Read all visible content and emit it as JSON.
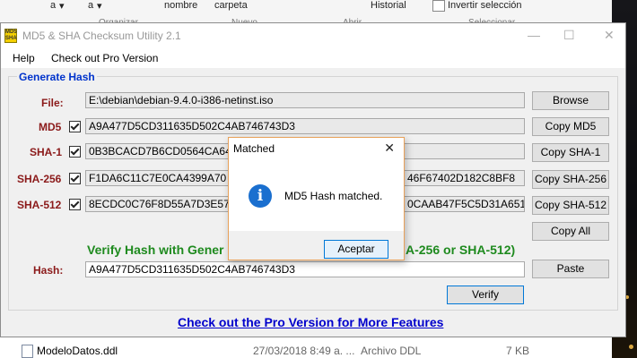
{
  "background": {
    "ribbon": {
      "row1": [
        "a",
        "a",
        "nombre",
        "carpeta",
        "Historial",
        "Invertir selección"
      ],
      "groups": [
        "Organizar",
        "Nuevo",
        "Abrir",
        "Seleccionar"
      ]
    },
    "files": [
      {
        "name": "ModeloDatos.ddl",
        "date": "27/03/2018 8:49 a. ...",
        "type": "Archivo DDL",
        "size": "7 KB"
      }
    ]
  },
  "app": {
    "title": "MD5 & SHA Checksum Utility 2.1",
    "icon_text": "MD5 SHA",
    "menu": [
      "Help",
      "Check out Pro Version"
    ],
    "group_title": "Generate Hash",
    "file": {
      "label": "File:",
      "value": "E:\\debian\\debian-9.4.0-i386-netinst.iso",
      "button": "Browse"
    },
    "hashes": [
      {
        "label": "MD5",
        "value": "A9A477D5CD311635D502C4AB746743D3",
        "button": "Copy MD5",
        "checked": true
      },
      {
        "label": "SHA-1",
        "value": "0B3BCACD7B6CD0564CA64",
        "button": "Copy SHA-1",
        "checked": true
      },
      {
        "label": "SHA-256",
        "value_left": "F1DA6C11C7E0CA4399A70",
        "value_right": "46F67402D182C8BF8",
        "button": "Copy SHA-256",
        "checked": true
      },
      {
        "label": "SHA-512",
        "value_left": "8ECDC0C76F8D55A7D3E57",
        "value_right": "0CAAB47F5C5D31A651",
        "button": "Copy SHA-512",
        "checked": true
      }
    ],
    "copy_all": "Copy All",
    "verify_title_left": "Verify Hash with Gener",
    "verify_title_right": "A-256 or SHA-512)",
    "hash": {
      "label": "Hash:",
      "value": "A9A477D5CD311635D502C4AB746743D3",
      "paste": "Paste"
    },
    "verify_button": "Verify",
    "pro_link": "Check out the Pro Version for More Features"
  },
  "dialog": {
    "title": "Matched",
    "message": "MD5 Hash matched.",
    "button": "Aceptar",
    "icon": "info-icon"
  }
}
